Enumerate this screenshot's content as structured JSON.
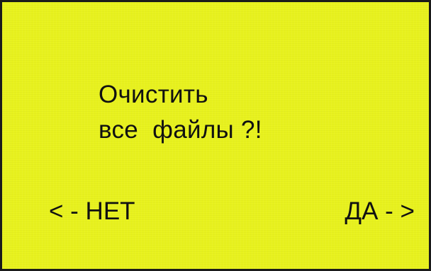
{
  "dialog": {
    "message_line_1": "Очистить",
    "message_line_2": "все  файлы ?!",
    "background_color": "#e8f21e"
  },
  "softkeys": {
    "left_label": "< - НЕТ",
    "right_label": "ДА - >"
  }
}
